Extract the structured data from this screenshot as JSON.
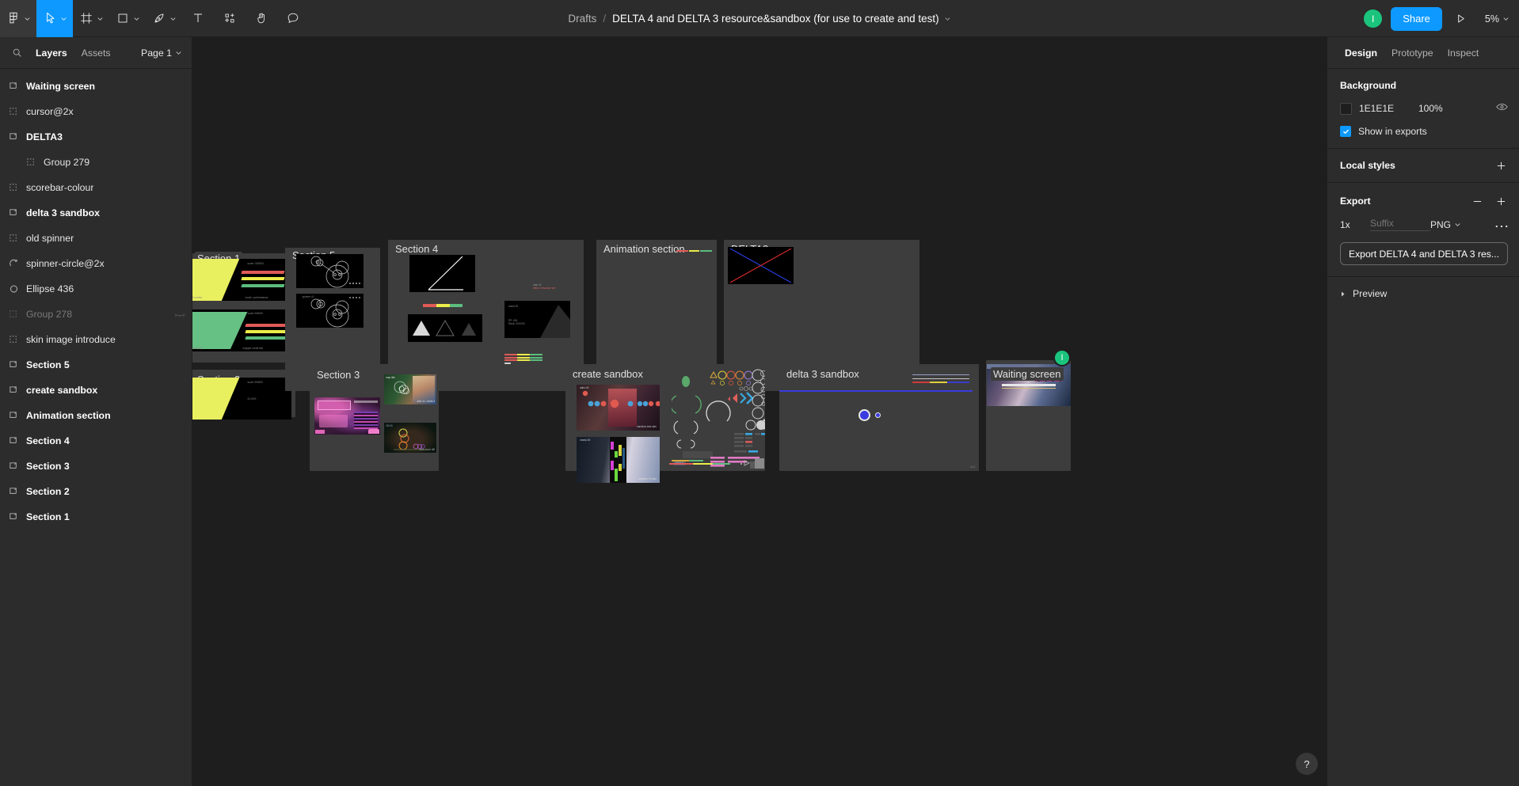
{
  "toolbar": {
    "menu_icon": "figma-logo-icon",
    "tools": [
      {
        "name": "main-menu",
        "icon": "figma-logo-icon",
        "has_chevron": true,
        "active": false
      },
      {
        "name": "move-tool",
        "icon": "cursor-arrow-icon",
        "has_chevron": true,
        "active": true
      },
      {
        "name": "frame-tool",
        "icon": "frame-icon",
        "has_chevron": true,
        "active": false
      },
      {
        "name": "shape-tool",
        "icon": "rectangle-icon",
        "has_chevron": true,
        "active": false
      },
      {
        "name": "pen-tool",
        "icon": "pen-icon",
        "has_chevron": true,
        "active": false
      },
      {
        "name": "text-tool",
        "icon": "text-t-icon",
        "has_chevron": false,
        "active": false
      },
      {
        "name": "resources-tool",
        "icon": "components-plus-icon",
        "has_chevron": false,
        "active": false
      },
      {
        "name": "hand-tool",
        "icon": "hand-icon",
        "has_chevron": false,
        "active": false
      },
      {
        "name": "comment-tool",
        "icon": "comment-bubble-icon",
        "has_chevron": false,
        "active": false
      }
    ]
  },
  "breadcrumb": {
    "project": "Drafts",
    "separator": "/",
    "file_title": "DELTA 4 and DELTA 3 resource&sandbox (for use to create and test)",
    "chevron_icon": "chevron-down-icon"
  },
  "header_right": {
    "avatar_initial": "I",
    "share_label": "Share",
    "present_icon": "play-triangle-icon",
    "zoom_level": "5%",
    "zoom_chevron_icon": "chevron-down-icon"
  },
  "sidebar": {
    "search_icon": "search-icon",
    "tabs": [
      {
        "label": "Layers",
        "selected": true
      },
      {
        "label": "Assets",
        "selected": false
      }
    ],
    "page_selector": "Page 1",
    "page_chevron_icon": "chevron-down-icon",
    "layers": [
      {
        "label": "Waiting screen",
        "icon": "frame-icon",
        "bold": true,
        "indent": false,
        "dim": false,
        "hidden_icon": false
      },
      {
        "label": "cursor@2x",
        "icon": "group-icon",
        "bold": false,
        "indent": false,
        "dim": false,
        "hidden_icon": false
      },
      {
        "label": "DELTA3",
        "icon": "frame-icon",
        "bold": true,
        "indent": false,
        "dim": false,
        "hidden_icon": false
      },
      {
        "label": "Group 279",
        "icon": "group-icon",
        "bold": false,
        "indent": true,
        "dim": false,
        "hidden_icon": false
      },
      {
        "label": "scorebar-colour",
        "icon": "group-icon",
        "bold": false,
        "indent": false,
        "dim": false,
        "hidden_icon": false
      },
      {
        "label": "delta 3 sandbox",
        "icon": "frame-icon",
        "bold": true,
        "indent": false,
        "dim": false,
        "hidden_icon": false
      },
      {
        "label": "old spinner",
        "icon": "group-icon",
        "bold": false,
        "indent": false,
        "dim": false,
        "hidden_icon": false
      },
      {
        "label": "spinner-circle@2x",
        "icon": "arc-icon",
        "bold": false,
        "indent": false,
        "dim": false,
        "hidden_icon": false
      },
      {
        "label": "Ellipse 436",
        "icon": "ellipse-icon",
        "bold": false,
        "indent": false,
        "dim": false,
        "hidden_icon": false
      },
      {
        "label": "Group 278",
        "icon": "group-icon",
        "bold": false,
        "indent": false,
        "dim": true,
        "hidden_icon": true
      },
      {
        "label": "skin image introduce",
        "icon": "group-icon",
        "bold": false,
        "indent": false,
        "dim": false,
        "hidden_icon": false
      },
      {
        "label": "Section 5",
        "icon": "frame-icon",
        "bold": true,
        "indent": false,
        "dim": false,
        "hidden_icon": false
      },
      {
        "label": "create sandbox",
        "icon": "frame-icon",
        "bold": true,
        "indent": false,
        "dim": false,
        "hidden_icon": false
      },
      {
        "label": "Animation section",
        "icon": "frame-icon",
        "bold": true,
        "indent": false,
        "dim": false,
        "hidden_icon": false
      },
      {
        "label": "Section 4",
        "icon": "frame-icon",
        "bold": true,
        "indent": false,
        "dim": false,
        "hidden_icon": false
      },
      {
        "label": "Section 3",
        "icon": "frame-icon",
        "bold": true,
        "indent": false,
        "dim": false,
        "hidden_icon": false
      },
      {
        "label": "Section 2",
        "icon": "frame-icon",
        "bold": true,
        "indent": false,
        "dim": false,
        "hidden_icon": false
      },
      {
        "label": "Section 1",
        "icon": "frame-icon",
        "bold": true,
        "indent": false,
        "dim": false,
        "hidden_icon": false
      }
    ]
  },
  "right_panel": {
    "tabs": [
      {
        "label": "Design",
        "selected": true
      },
      {
        "label": "Prototype",
        "selected": false
      },
      {
        "label": "Inspect",
        "selected": false
      }
    ],
    "background": {
      "heading": "Background",
      "color_hex": "1E1E1E",
      "swatch_color": "#1e1e1e",
      "opacity": "100%",
      "visibility_icon": "eye-icon",
      "show_in_exports_label": "Show in exports",
      "show_in_exports_checked": true
    },
    "local_styles": {
      "heading": "Local styles",
      "add_icon": "plus-icon"
    },
    "export": {
      "heading": "Export",
      "remove_icon": "minus-icon",
      "add_icon": "plus-icon",
      "scale": "1x",
      "suffix_placeholder": "Suffix",
      "format": "PNG",
      "format_chevron_icon": "chevron-down-icon",
      "more_icon": "ellipsis-icon",
      "export_button_label": "Export DELTA 4 and DELTA 3 res...",
      "preview_label": "Preview",
      "preview_chevron_icon": "chevron-right-icon"
    }
  },
  "canvas": {
    "help_button": "?",
    "cursor_badge_initial": "I",
    "sections": [
      {
        "name": "section-1",
        "label": "Section 1"
      },
      {
        "name": "section-2",
        "label": "Section 2"
      },
      {
        "name": "section-5",
        "label": "Section 5"
      },
      {
        "name": "section-4",
        "label": "Section 4"
      },
      {
        "name": "animation-section",
        "label": "Animation section"
      },
      {
        "name": "delta3-section",
        "label": "DELTA3"
      },
      {
        "name": "section-3",
        "label": "Section 3"
      },
      {
        "name": "create-sandbox",
        "label": "create sandbox"
      },
      {
        "name": "delta-3-sandbox",
        "label": "delta 3 sandbox"
      },
      {
        "name": "waiting-screen",
        "label": "Waiting screen"
      }
    ]
  },
  "colors": {
    "accent_blue": "#0d99ff",
    "canvas_bg": "#1e1e1e",
    "panel_bg": "#2c2c2c",
    "section_bg": "#3d3d3d",
    "green_avatar": "#1bc47d",
    "bar_red": "#e05a57",
    "bar_yellow": "#ecec4a",
    "bar_green": "#5bbd7e"
  }
}
